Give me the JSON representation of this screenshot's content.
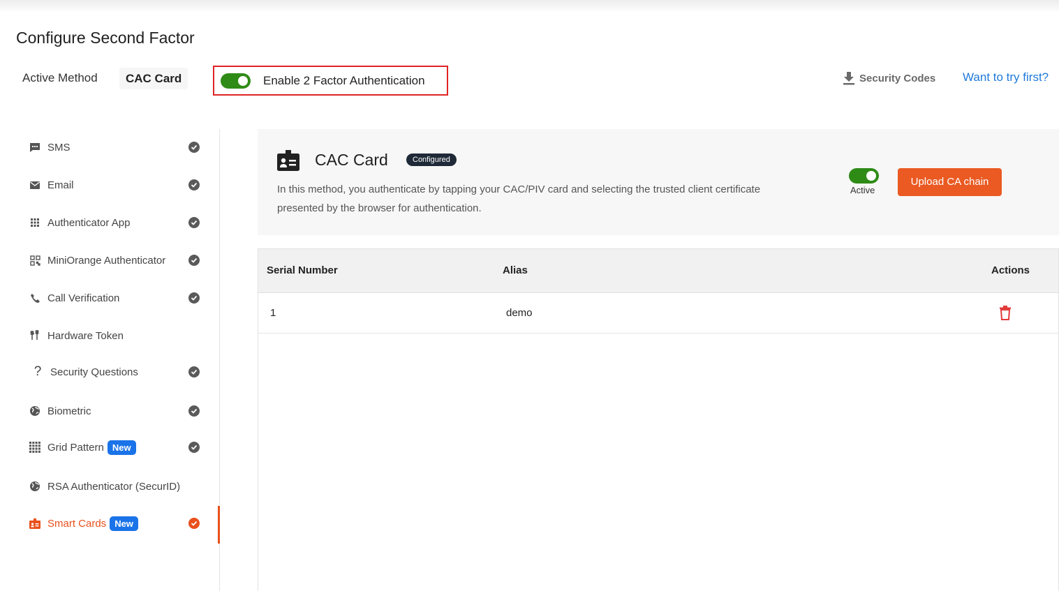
{
  "header": {
    "title": "Configure Second Factor",
    "active_method_label": "Active Method",
    "active_method_value": "CAC Card",
    "enable_label": "Enable 2 Factor Authentication",
    "enable_on": true,
    "security_codes": "Security Codes",
    "try_first": "Want to try first?"
  },
  "sidebar": {
    "items": [
      {
        "label": "SMS",
        "icon": "sms-icon",
        "checked": true
      },
      {
        "label": "Email",
        "icon": "email-icon",
        "checked": true
      },
      {
        "label": "Authenticator App",
        "icon": "app-grid-icon",
        "checked": true
      },
      {
        "label": "MiniOrange Authenticator",
        "icon": "qr-icon",
        "checked": true
      },
      {
        "label": "Call Verification",
        "icon": "phone-icon",
        "checked": true
      },
      {
        "label": "Hardware Token",
        "icon": "usb-icon",
        "checked": false
      },
      {
        "label": "Security Questions",
        "icon": "question-icon",
        "checked": true
      },
      {
        "label": "Biometric",
        "icon": "globe-icon",
        "checked": true
      },
      {
        "label": "Grid Pattern",
        "icon": "grid-icon",
        "checked": true,
        "badge": "New"
      },
      {
        "label": "RSA Authenticator (SecurID)",
        "icon": "globe-icon",
        "checked": false
      },
      {
        "label": "Smart Cards",
        "icon": "id-card-icon",
        "checked": true,
        "badge": "New",
        "active": true
      }
    ]
  },
  "method_card": {
    "title": "CAC Card",
    "status_badge": "Configured",
    "description": "In this method, you authenticate by tapping your CAC/PIV card and selecting the trusted client certificate presented by the browser for authentication.",
    "toggle_label": "Active",
    "upload_button": "Upload CA chain"
  },
  "table": {
    "columns": [
      "Serial Number",
      "Alias",
      "Actions"
    ],
    "rows": [
      {
        "serial": "1",
        "alias": "demo"
      }
    ]
  },
  "colors": {
    "accent": "#ea5a22",
    "toggle_on": "#2e8b16",
    "link": "#1f7ad9",
    "badge_new": "#1a73e8",
    "highlight_border": "#e02424"
  }
}
